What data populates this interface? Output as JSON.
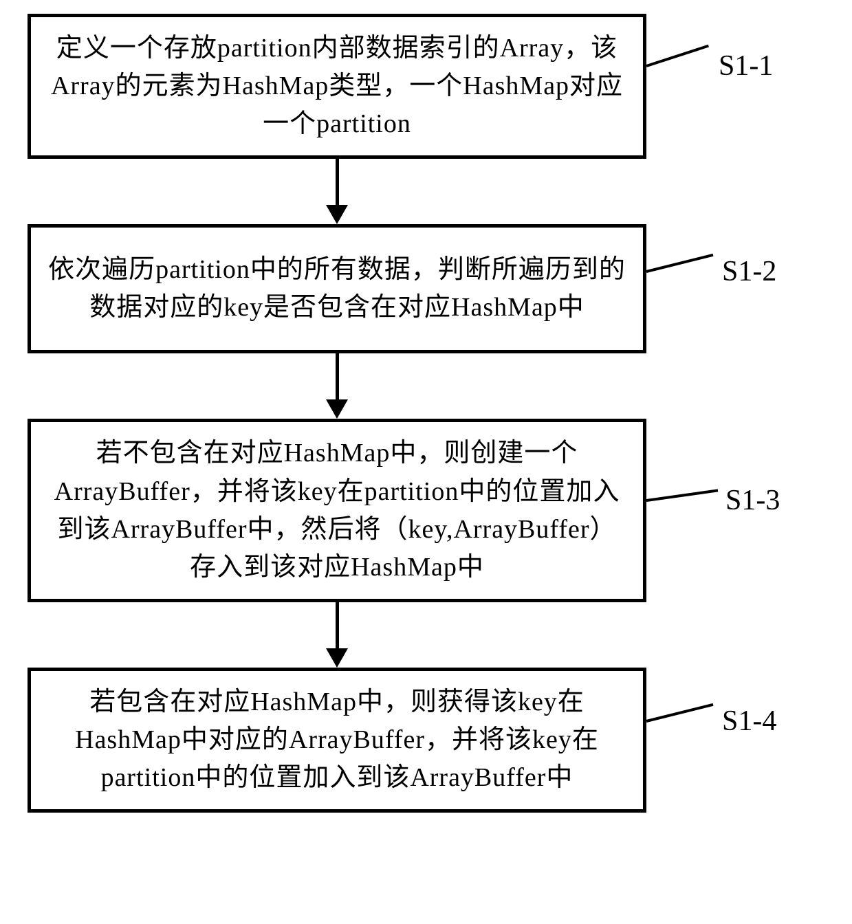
{
  "flow": {
    "steps": [
      {
        "label": "S1-1",
        "text": "定义一个存放partition内部数据索引的Array，该Array的元素为HashMap类型，一个HashMap对应一个partition"
      },
      {
        "label": "S1-2",
        "text": "依次遍历partition中的所有数据，判断所遍历到的数据对应的key是否包含在对应HashMap中"
      },
      {
        "label": "S1-3",
        "text": "若不包含在对应HashMap中，则创建一个ArrayBuffer，并将该key在partition中的位置加入到该ArrayBuffer中，然后将（key,ArrayBuffer）存入到该对应HashMap中"
      },
      {
        "label": "S1-4",
        "text": "若包含在对应HashMap中，则获得该key在HashMap中对应的ArrayBuffer，并将该key在partition中的位置加入到该ArrayBuffer中"
      }
    ]
  }
}
